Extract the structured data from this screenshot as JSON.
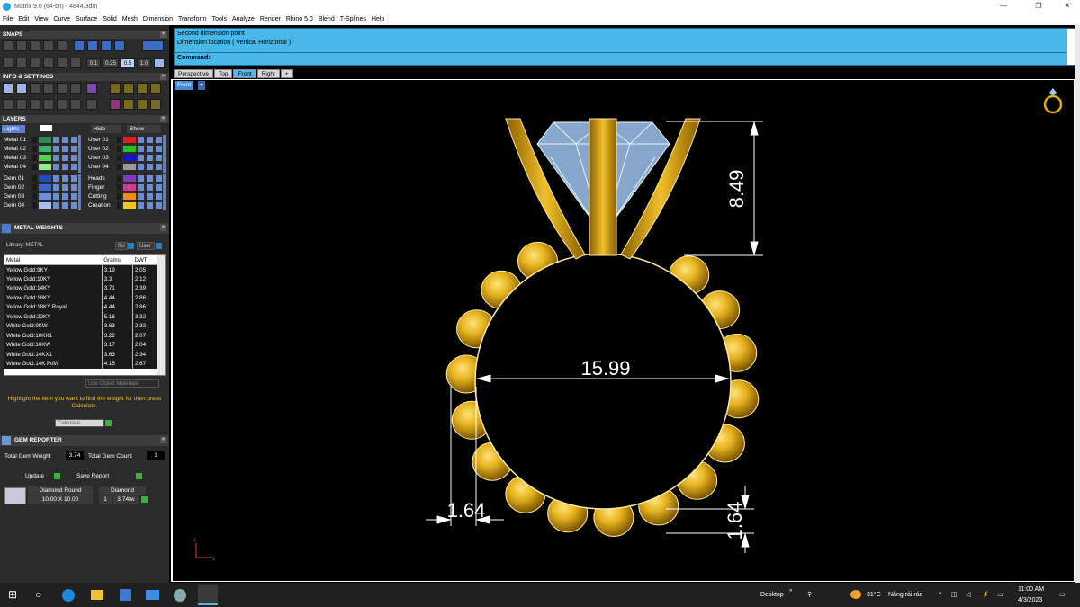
{
  "window": {
    "title": "Matrix 9.0 (64-bit) - 4844.3dm",
    "min": "—",
    "restore": "❐",
    "close": "✕"
  },
  "menu": [
    "File",
    "Edit",
    "View",
    "Curve",
    "Surface",
    "Solid",
    "Mesh",
    "Dimension",
    "Transform",
    "Tools",
    "Analyze",
    "Render",
    "Rhino 5.0",
    "Blend",
    "T-Splines",
    "Help"
  ],
  "panels": {
    "snaps": "SNAPS",
    "info": "INFO & SETTINGS",
    "layers": "LAYERS",
    "metal_weights": "METAL WEIGHTS",
    "gem_reporter": "GEM REPORTER"
  },
  "snap_values": [
    "0.1",
    "0.25",
    "0.5",
    "1.0"
  ],
  "layers": {
    "lights": "Lights",
    "hide": "Hide",
    "show": "Show",
    "left": [
      {
        "name": "Metal 01",
        "color": "#2e8b57"
      },
      {
        "name": "Metal 02",
        "color": "#3cb371"
      },
      {
        "name": "Metal 03",
        "color": "#55d055"
      },
      {
        "name": "Metal 04",
        "color": "#90ee90"
      },
      {
        "name": "Gem 01",
        "color": "#1e4db7"
      },
      {
        "name": "Gem 02",
        "color": "#3a66d1"
      },
      {
        "name": "Gem 03",
        "color": "#6c8fe0"
      },
      {
        "name": "Gem 04",
        "color": "#a9c0f0"
      }
    ],
    "right": [
      {
        "name": "User 01",
        "color": "#e02020"
      },
      {
        "name": "User 02",
        "color": "#22c022"
      },
      {
        "name": "User 03",
        "color": "#1414d8"
      },
      {
        "name": "User 04",
        "color": "#9a9a9a"
      },
      {
        "name": "Heads",
        "color": "#7b3fb8"
      },
      {
        "name": "Finger",
        "color": "#d23c8c"
      },
      {
        "name": "Cutting",
        "color": "#f08c1e"
      },
      {
        "name": "Creation",
        "color": "#f0c81e"
      }
    ]
  },
  "metal": {
    "library_label": "Library: METAL",
    "lib_btn1": "0U",
    "lib_btn2": "User",
    "headers": [
      "Metal",
      "Grams",
      "DWT"
    ],
    "rows": [
      [
        "Yellow Gold:9KY",
        "3.19",
        "2.05"
      ],
      [
        "Yellow Gold:10KY",
        "3.3",
        "2.12"
      ],
      [
        "Yellow Gold:14KY",
        "3.71",
        "2.39"
      ],
      [
        "Yellow Gold:18KY",
        "4.44",
        "2.86"
      ],
      [
        "Yellow Gold:18KY Royal",
        "4.44",
        "2.86"
      ],
      [
        "Yellow Gold:22KY",
        "5.16",
        "3.32"
      ],
      [
        "White Gold:9KW",
        "3.63",
        "2.33"
      ],
      [
        "White Gold:10KX1",
        "3.22",
        "2.07"
      ],
      [
        "White Gold:10KW",
        "3.17",
        "2.04"
      ],
      [
        "White Gold:14KX1",
        "3.63",
        "2.34"
      ],
      [
        "White Gold:14K PdW",
        "4.15",
        "2.67"
      ]
    ],
    "use_object_materials": "Use Object Materials",
    "hint": "Highlight the item you want to find the weight for then press Calculate.",
    "calculate": "Calculate"
  },
  "gem": {
    "total_weight_label": "Total Gem Weight",
    "total_weight": "3.74",
    "total_count_label": "Total Gem Count",
    "total_count": "1",
    "update": "Update",
    "save_report": "Save Report",
    "gem_type": "Diamond Round",
    "gem_size": "10.00 X 10.00",
    "col2_head": "Diamond",
    "qty": "1",
    "weight": "3.74tw"
  },
  "command": {
    "line1": "Second dimension point",
    "line2": "Dimension location ( Vertical  Horizontal )",
    "prompt": "Command:"
  },
  "viewport_tabs": [
    "Perspective",
    "Top",
    "Front",
    "Right",
    "+"
  ],
  "active_tab": "Front",
  "viewport_label": "Front",
  "dimensions": {
    "height": "8.49",
    "diameter": "15.99",
    "left_thickness": "1.64",
    "bottom_thickness": "1.64"
  },
  "axis": {
    "z": "z",
    "x": "x"
  },
  "colors": {
    "gold": "#e0a818",
    "gem": "#9fc6f0",
    "dim": "#ffffff",
    "cmd": "#48b8e8"
  },
  "taskbar": {
    "desktop": "Desktop",
    "temp": "31°C",
    "weather": "Nắng rải rác",
    "time": "11:00 AM",
    "date": "4/3/2023"
  }
}
